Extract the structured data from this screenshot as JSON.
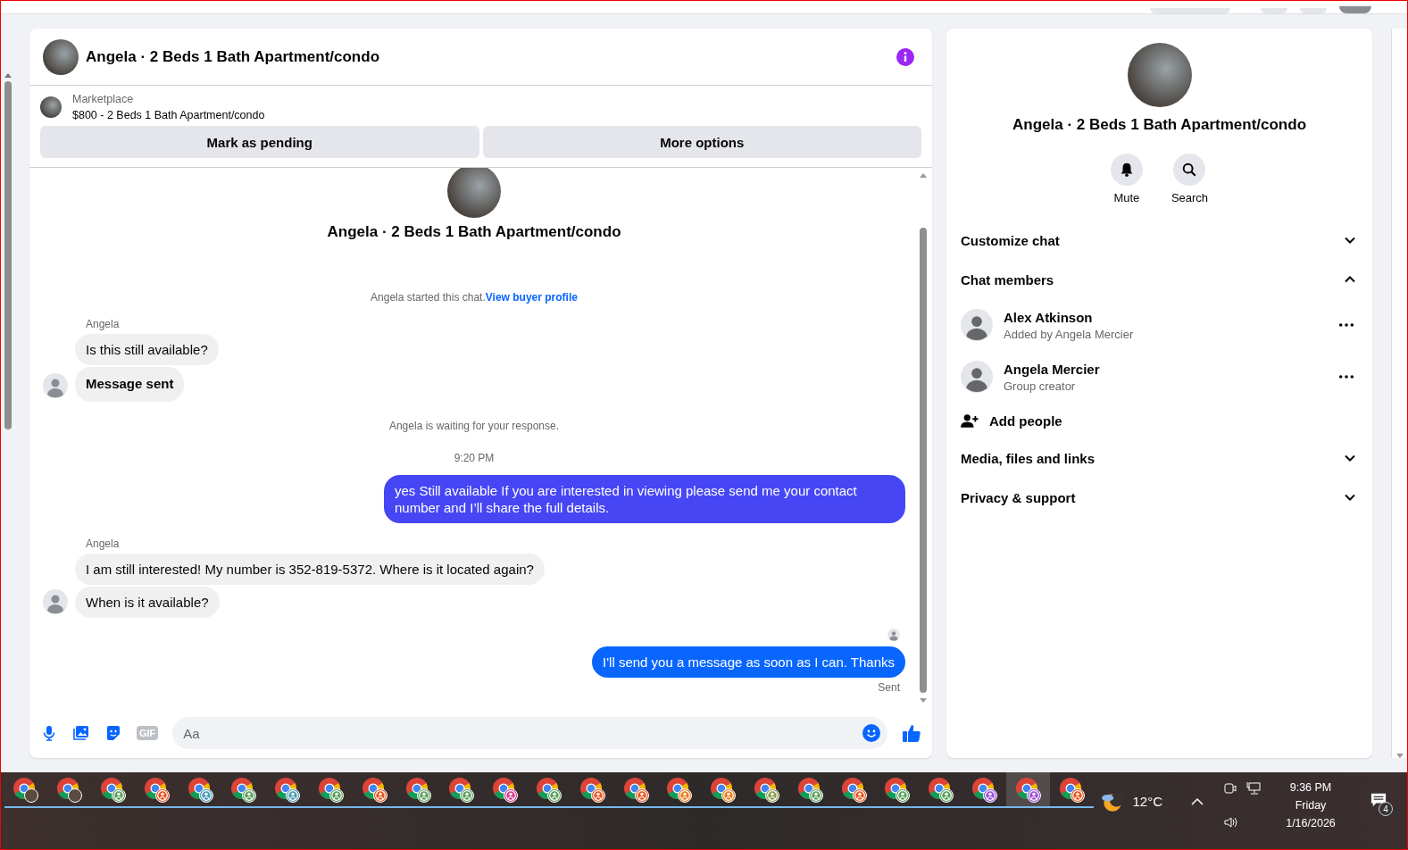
{
  "chat": {
    "title": "Angela · 2 Beds 1 Bath Apartment/condo",
    "listing": {
      "label": "Marketplace",
      "title": "$800 - 2 Beds 1 Bath Apartment/condo"
    },
    "actions": [
      "Mark as pending",
      "More options"
    ],
    "timeline": [
      {
        "kind": "intro",
        "text": "Angela · 2 Beds 1 Bath Apartment/condo"
      },
      {
        "kind": "notice",
        "text": "Angela started this chat.",
        "link": "View buyer profile"
      },
      {
        "kind": "incoming",
        "sender": "Angela",
        "messages": [
          {
            "text": "Is this still available?",
            "emphasis": false
          },
          {
            "text": "Message sent",
            "emphasis": true
          }
        ]
      },
      {
        "kind": "notice",
        "text": "Angela is waiting for your response."
      },
      {
        "kind": "time",
        "text": "9:20 PM"
      },
      {
        "kind": "outgoing",
        "messages": [
          {
            "text": "yes Still available If you are interested in viewing please send me your contact number and I’ll share the full details.",
            "color": "#4646f5"
          }
        ]
      },
      {
        "kind": "incoming",
        "sender": "Angela",
        "messages": [
          {
            "text": "I am still interested! My number  is 352-819-5372. Where is it located again?",
            "emphasis": false
          },
          {
            "text": "When is it available?",
            "emphasis": false
          }
        ]
      },
      {
        "kind": "seen"
      },
      {
        "kind": "outgoing",
        "messages": [
          {
            "text": "I'll send you a message as soon as I can. Thanks",
            "color": "#0866ff"
          }
        ]
      },
      {
        "kind": "status",
        "text": "Sent"
      }
    ],
    "composer": {
      "gif_label": "GIF",
      "placeholder": "Aa"
    }
  },
  "details": {
    "title": "Angela · 2 Beds 1 Bath Apartment/condo",
    "actions": [
      {
        "kind": "bell",
        "label": "Mute"
      },
      {
        "kind": "search",
        "label": "Search"
      }
    ],
    "sections": [
      {
        "kind": "section",
        "label": "Customize chat",
        "expanded": false
      },
      {
        "kind": "section",
        "label": "Chat members",
        "expanded": true,
        "members": [
          {
            "name": "Alex Atkinson",
            "note": "Added by Angela Mercier"
          },
          {
            "name": "Angela Mercier",
            "note": "Group creator"
          }
        ],
        "add_label": "Add people"
      },
      {
        "kind": "section",
        "label": "Media, files and links",
        "expanded": false
      },
      {
        "kind": "section",
        "label": "Privacy & support",
        "expanded": false
      }
    ]
  },
  "taskbar": {
    "apps": [
      {
        "kind": "photo",
        "selected": false
      },
      {
        "kind": "photo",
        "selected": false
      },
      {
        "kind": "badge",
        "color": "#5a9e5a",
        "selected": false
      },
      {
        "kind": "badge",
        "color": "#e8541e",
        "selected": false
      },
      {
        "kind": "badge",
        "color": "#4a9ab5",
        "selected": false
      },
      {
        "kind": "badge",
        "color": "#5a9e5a",
        "selected": false
      },
      {
        "kind": "badge",
        "color": "#4a9ab5",
        "selected": false
      },
      {
        "kind": "badge",
        "color": "#5a9e5a",
        "selected": false
      },
      {
        "kind": "badge",
        "color": "#e8541e",
        "selected": false
      },
      {
        "kind": "badge",
        "color": "#5a9e5a",
        "selected": false
      },
      {
        "kind": "badge",
        "color": "#5a9e5a",
        "selected": false
      },
      {
        "kind": "badge",
        "color": "#d63c91",
        "selected": false
      },
      {
        "kind": "badge",
        "color": "#5a9e5a",
        "selected": false
      },
      {
        "kind": "badge",
        "color": "#e8541e",
        "selected": false
      },
      {
        "kind": "badge",
        "color": "#e8541e",
        "selected": false
      },
      {
        "kind": "badge",
        "color": "#ef7a1a",
        "selected": false
      },
      {
        "kind": "badge",
        "color": "#ef7a1a",
        "selected": false
      },
      {
        "kind": "badge",
        "color": "#8a9a4a",
        "selected": false
      },
      {
        "kind": "badge",
        "color": "#5a9e5a",
        "selected": false
      },
      {
        "kind": "badge",
        "color": "#e8541e",
        "selected": false
      },
      {
        "kind": "badge",
        "color": "#5a9e5a",
        "selected": false
      },
      {
        "kind": "badge",
        "color": "#5a9e5a",
        "selected": false
      },
      {
        "kind": "badge",
        "color": "#9b4fd6",
        "selected": false
      },
      {
        "kind": "badge",
        "color": "#9b4fd6",
        "selected": true
      },
      {
        "kind": "badge",
        "color": "#e8541e",
        "selected": false
      }
    ],
    "weather": "12°C",
    "time": "9:36 PM",
    "day": "Friday",
    "date": "1/16/2026",
    "notifications": "4"
  }
}
